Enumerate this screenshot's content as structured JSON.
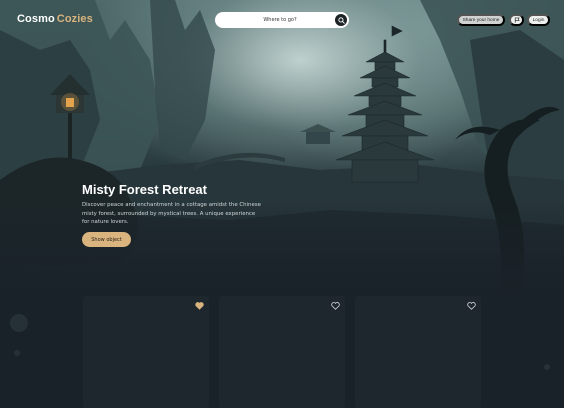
{
  "header": {
    "logo_part1": "Cosmo",
    "logo_part2": "Cozies",
    "search_placeholder": "Where to go?",
    "share_label": "Share your home",
    "login_label": "Login"
  },
  "hero": {
    "title": "Misty Forest Retreat",
    "description": "Discover peace and enchantment in a cottage amidst the Chinese misty forest, surrounded by mystical trees. A unique experience for nature lovers.",
    "cta_label": "Show object"
  },
  "cards": [
    {
      "favorited": true
    },
    {
      "favorited": false
    },
    {
      "favorited": false
    }
  ],
  "colors": {
    "accent": "#d9b47e",
    "background": "#1a2229",
    "card": "#1f272e"
  },
  "icons": {
    "search": "search-icon",
    "flag": "flag-icon",
    "heart": "heart-icon"
  }
}
